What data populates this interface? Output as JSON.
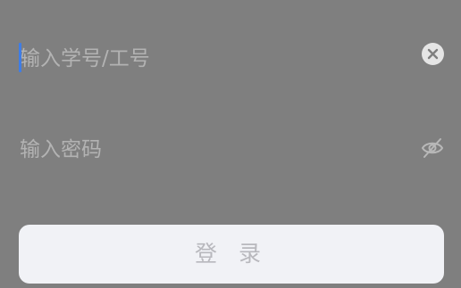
{
  "login_form": {
    "account": {
      "value": "",
      "placeholder": "输入学号/工号",
      "clear_icon": "close-circle-icon"
    },
    "password": {
      "value": "",
      "placeholder": "输入密码",
      "visibility_icon": "eye-off-icon"
    },
    "submit_label": "登 录"
  },
  "colors": {
    "background": "#7f7f7f",
    "placeholder_text": "#b3b3b3",
    "caret": "#3f7de6",
    "button_bg": "#f1f2f6",
    "button_text": "#b8b8bd"
  }
}
